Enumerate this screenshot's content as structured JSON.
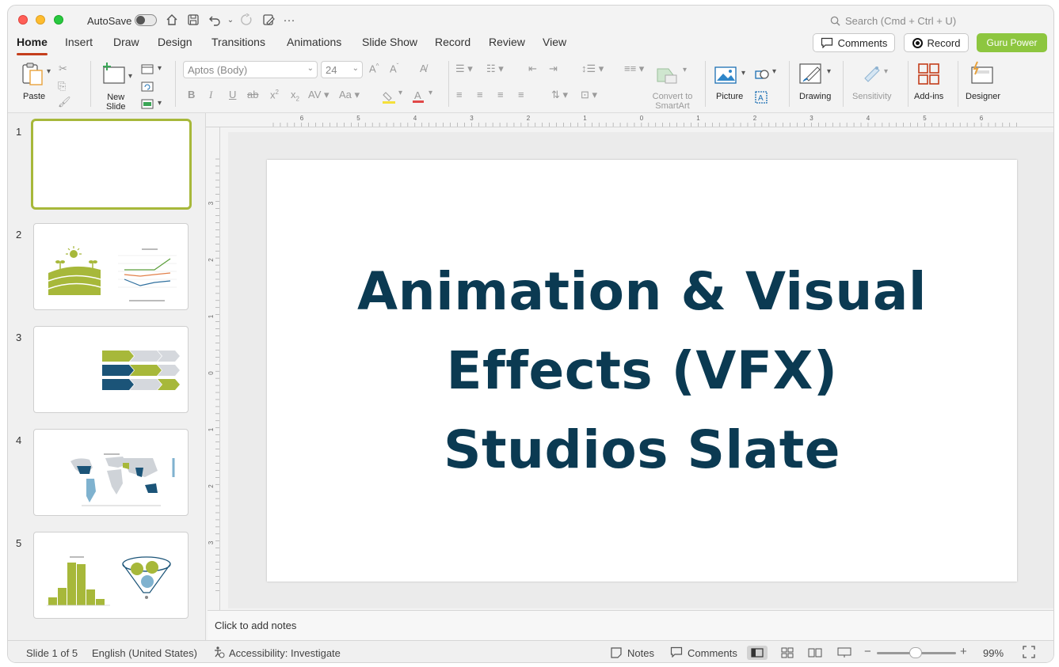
{
  "titlebar": {
    "autosave_label": "AutoSave",
    "search_placeholder": "Search (Cmd + Ctrl + U)"
  },
  "tabs": [
    {
      "label": "Home"
    },
    {
      "label": "Insert"
    },
    {
      "label": "Draw"
    },
    {
      "label": "Design"
    },
    {
      "label": "Transitions"
    },
    {
      "label": "Animations"
    },
    {
      "label": "Slide Show"
    },
    {
      "label": "Record"
    },
    {
      "label": "Review"
    },
    {
      "label": "View"
    }
  ],
  "header_buttons": {
    "comments": "Comments",
    "record": "Record",
    "guru": "Guru Power",
    "guru_color": "#8dc63f"
  },
  "ribbon": {
    "paste": "Paste",
    "new_slide": "New\nSlide",
    "font_name": "Aptos (Body)",
    "font_size": "24",
    "convert_smartart": "Convert to\nSmartArt",
    "picture": "Picture",
    "drawing": "Drawing",
    "sensitivity": "Sensitivity",
    "addins": "Add-ins",
    "designer": "Designer"
  },
  "thumbnails": [
    {
      "number": "1"
    },
    {
      "number": "2"
    },
    {
      "number": "3"
    },
    {
      "number": "4"
    },
    {
      "number": "5"
    }
  ],
  "ruler": {
    "h_labels": [
      "6",
      "5",
      "4",
      "3",
      "2",
      "1",
      "0",
      "1",
      "2",
      "3",
      "4",
      "5",
      "6"
    ],
    "v_labels": [
      "3",
      "2",
      "1",
      "0",
      "1",
      "2",
      "3"
    ]
  },
  "slide": {
    "title": "Animation & Visual Effects (VFX) Studios Slate",
    "title_color": "#0b3a52"
  },
  "notes_placeholder": "Click to add notes",
  "status": {
    "slide_count": "Slide 1 of 5",
    "language": "English (United States)",
    "accessibility": "Accessibility: Investigate",
    "notes": "Notes",
    "comments": "Comments",
    "zoom": "99%"
  },
  "icons": {
    "brand_accent": "#c43e1c",
    "green": "#a7b83a",
    "navy": "#1b5478"
  }
}
